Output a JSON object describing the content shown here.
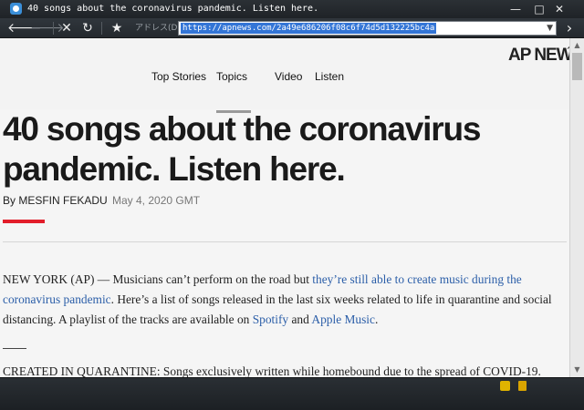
{
  "window": {
    "title": "40 songs about the coronavirus pandemic. Listen here.",
    "controls": {
      "minimize": "—",
      "maximize": "□",
      "close": "✕"
    }
  },
  "toolbar": {
    "back": "🡐",
    "forward": "🡒",
    "stop": "✕",
    "reload": "↻",
    "favorite": "★",
    "address_label": "アドレス(D)",
    "url": "https://apnews.com/2a49e686206f08c6f74d5d132225bc4a",
    "go": "›"
  },
  "site": {
    "logo": "AP NEWS",
    "nav": [
      "Top Stories",
      "Topics",
      "Video",
      "Listen"
    ]
  },
  "article": {
    "headline": "40 songs about the coronavirus pandemic. Listen here.",
    "byline": "By MESFIN FEKADU",
    "date": "May 4, 2020 GMT",
    "p1_a": "NEW YORK (AP) — Musicians can’t perform on the road but ",
    "p1_link1": "they’re still able to create music during the coronavirus pandemic",
    "p1_b": ". Here’s a list of songs released in the last six weeks related to life in quarantine and social distancing. A playlist of the tracks are available on ",
    "p1_link2": "Spotify",
    "p1_c": " and ",
    "p1_link3": "Apple Music",
    "p1_d": ".",
    "p2": "CREATED IN QUARANTINE: Songs exclusively written while homebound due to the spread of COVID-19."
  },
  "colors": {
    "accent_red": "#e21d2a",
    "link": "#2b5ea8",
    "selection": "#3375d6"
  }
}
